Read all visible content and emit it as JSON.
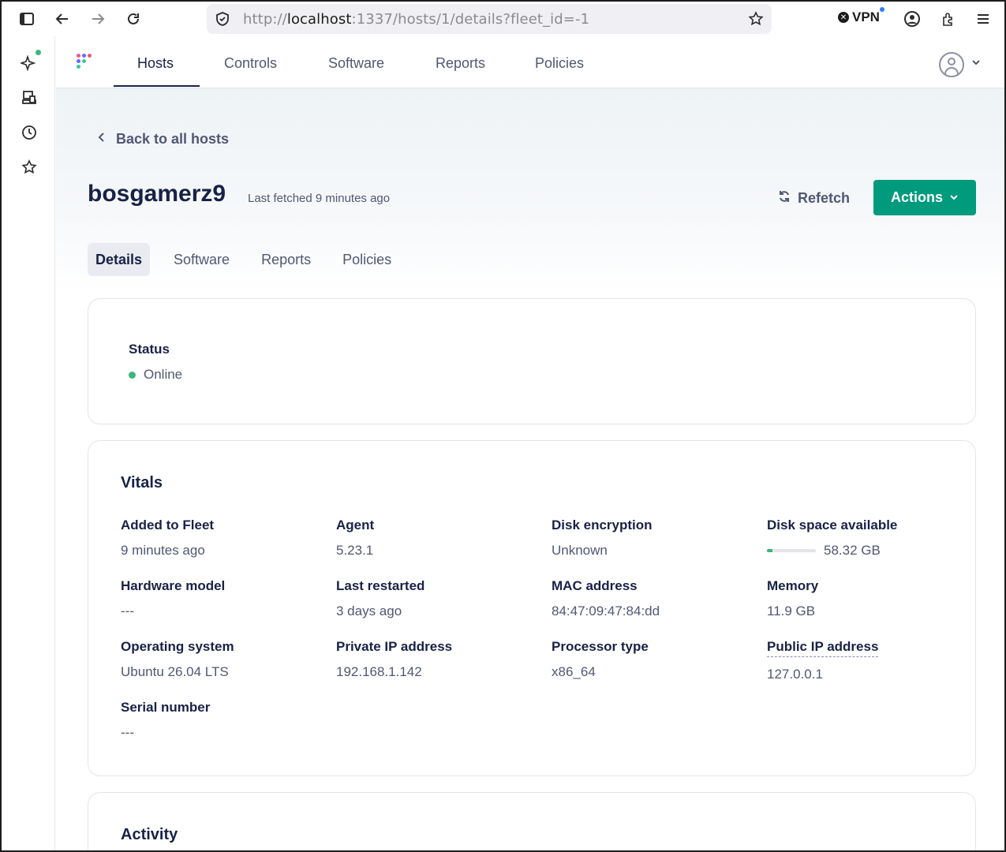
{
  "browser": {
    "url_prefix": "http://",
    "url_host": "localhost",
    "url_rest": ":1337/hosts/1/details?fleet_id=-1",
    "vpn_label": "VPN",
    "icons": [
      "sidebar-toggle-icon",
      "back-arrow-icon",
      "forward-arrow-icon",
      "reload-icon",
      "shield-icon",
      "bookmark-star-icon",
      "account-icon",
      "extensions-icon",
      "menu-icon"
    ]
  },
  "sidebar": {
    "icons": [
      "ai-sparkle-icon",
      "synced-tabs-icon",
      "history-icon",
      "bookmarks-icon"
    ]
  },
  "nav": {
    "items": [
      "Hosts",
      "Controls",
      "Software",
      "Reports",
      "Policies"
    ],
    "active": "Hosts"
  },
  "host": {
    "back_label": "Back to all hosts",
    "name": "bosgamerz9",
    "last_fetched": "Last fetched 9 minutes ago",
    "refetch_label": "Refetch",
    "actions_label": "Actions"
  },
  "tabs": {
    "items": [
      "Details",
      "Software",
      "Reports",
      "Policies"
    ],
    "active": "Details"
  },
  "status": {
    "label": "Status",
    "value": "Online",
    "color": "#3db67b"
  },
  "vitals": {
    "title": "Vitals",
    "items": [
      {
        "label": "Added to Fleet",
        "value": "9 minutes ago"
      },
      {
        "label": "Agent",
        "value": "5.23.1"
      },
      {
        "label": "Disk encryption",
        "value": "Unknown"
      },
      {
        "label": "Disk space available",
        "value": "58.32 GB",
        "fill_fraction": 0.12
      },
      {
        "label": "Hardware model",
        "value": "---"
      },
      {
        "label": "Last restarted",
        "value": "3 days ago"
      },
      {
        "label": "MAC address",
        "value": "84:47:09:47:84:dd"
      },
      {
        "label": "Memory",
        "value": "11.9 GB"
      },
      {
        "label": "Operating system",
        "value": "Ubuntu 26.04 LTS"
      },
      {
        "label": "Private IP address",
        "value": "192.168.1.142"
      },
      {
        "label": "Processor type",
        "value": "x86_64"
      },
      {
        "label": "Public IP address",
        "value": "127.0.0.1"
      },
      {
        "label": "Serial number",
        "value": "---"
      }
    ]
  },
  "activity": {
    "title": "Activity"
  },
  "colors": {
    "brand_green": "#009a7d",
    "online_green": "#3db67b",
    "text_dark": "#192147",
    "text_muted": "#515774"
  }
}
